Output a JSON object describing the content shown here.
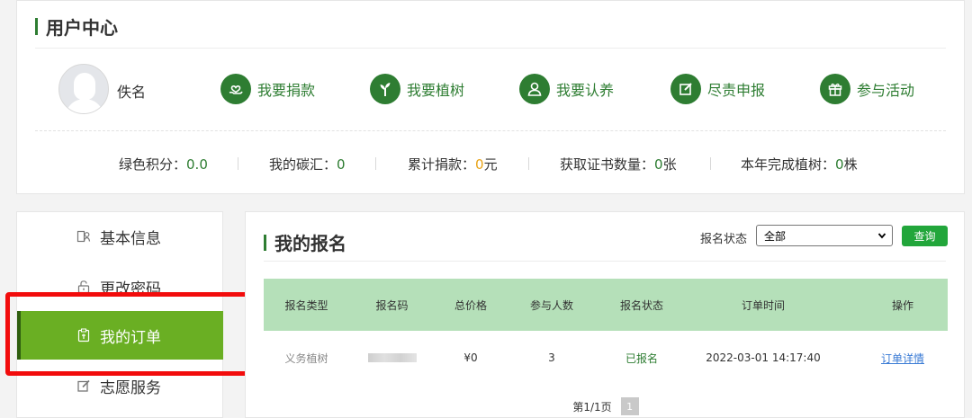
{
  "user_center": {
    "title": "用户中心",
    "username": "佚名",
    "actions": [
      {
        "label": "我要捐款",
        "icon": "heart-hand-icon"
      },
      {
        "label": "我要植树",
        "icon": "tree-icon"
      },
      {
        "label": "我要认养",
        "icon": "person-icon"
      },
      {
        "label": "尽责申报",
        "icon": "edit-icon"
      },
      {
        "label": "参与活动",
        "icon": "gift-icon"
      }
    ],
    "stats": [
      {
        "label": "绿色积分：",
        "value": "0.0",
        "unit": ""
      },
      {
        "label": "我的碳汇：",
        "value": "0",
        "unit": ""
      },
      {
        "label": "累计捐款：",
        "value": "0",
        "unit": "元"
      },
      {
        "label": "获取证书数量：",
        "value": "0",
        "unit": "张"
      },
      {
        "label": "本年完成植树：",
        "value": "0",
        "unit": "株"
      }
    ]
  },
  "sidebar": {
    "items": [
      {
        "label": "基本信息",
        "icon": "profile-card-icon"
      },
      {
        "label": "更改密码",
        "icon": "lock-icon"
      },
      {
        "label": "我的订单",
        "icon": "clipboard-icon",
        "active": true
      },
      {
        "label": "志愿服务",
        "icon": "edit-icon"
      }
    ]
  },
  "main": {
    "title": "我的报名",
    "filter": {
      "label": "报名状态",
      "selected": "全部",
      "button": "查询"
    },
    "table": {
      "headers": [
        "报名类型",
        "报名码",
        "总价格",
        "参与人数",
        "报名状态",
        "订单时间",
        "操作"
      ],
      "rows": [
        {
          "type": "义务植树",
          "code": "",
          "price": "¥0",
          "count": "3",
          "status": "已报名",
          "time": "2022-03-01 14:17:40",
          "action": "订单详情"
        }
      ]
    },
    "pagination": {
      "text": "第1/1页",
      "current": "1"
    }
  },
  "colors": {
    "brand_green": "#2e7d32",
    "active_menu": "#6aaf23",
    "table_header": "#b5e0b9",
    "highlight": "#f20c0c"
  }
}
